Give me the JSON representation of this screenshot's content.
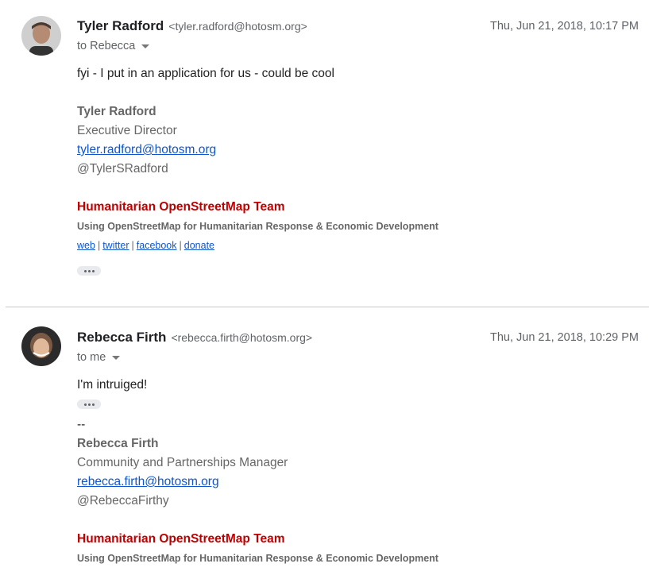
{
  "messages": [
    {
      "sender_name": "Tyler Radford",
      "sender_email": "<tyler.radford@hotosm.org>",
      "date": "Thu, Jun 21, 2018, 10:17 PM",
      "to": "to Rebecca",
      "body": "fyi - I put in an application for us - could be cool",
      "signature": {
        "name": "Tyler Radford",
        "title": "Executive Director",
        "email": "tyler.radford@hotosm.org",
        "handle": "@TylerSRadford",
        "org": "Humanitarian OpenStreetMap Team",
        "tagline": "Using OpenStreetMap for Humanitarian Response & Economic Development",
        "links": [
          "web",
          "twitter",
          "facebook",
          "donate"
        ]
      }
    },
    {
      "sender_name": "Rebecca Firth",
      "sender_email": "<rebecca.firth@hotosm.org>",
      "date": "Thu, Jun 21, 2018, 10:29 PM",
      "to": "to me",
      "body": "I'm intruiged!",
      "signature": {
        "dashes": "--",
        "name": "Rebecca Firth",
        "title": "Community and Partnerships Manager",
        "email": "rebecca.firth@hotosm.org",
        "handle": "@RebeccaFirthy",
        "org": "Humanitarian OpenStreetMap Team",
        "tagline": "Using OpenStreetMap for Humanitarian Response & Economic Development"
      }
    }
  ],
  "colors": {
    "link": "#1155cc",
    "org_red": "#c00000",
    "signature_gray": "#666666"
  }
}
